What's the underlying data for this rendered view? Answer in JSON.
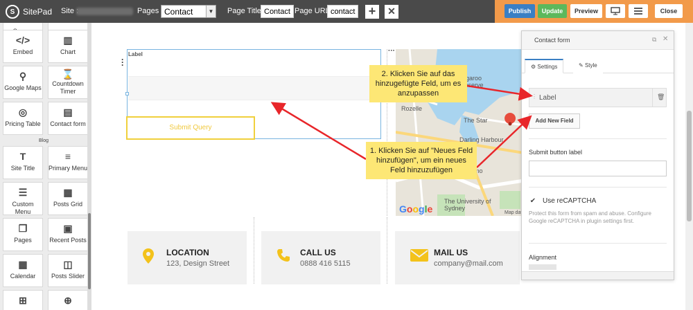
{
  "topbar": {
    "brand": "SitePad",
    "site_label": "Site :",
    "pages_label": "Pages :",
    "pages_value": "Contact",
    "page_title_label": "Page Title:",
    "page_title_value": "Contact",
    "page_url_label": "Page URL:",
    "page_url_value": "contact",
    "add_icon": "+",
    "close_icon": "✕",
    "publish": "Publish",
    "update": "Update",
    "preview": "Preview",
    "close": "Close",
    "colors": {
      "bar": "#4a4a4a",
      "accent": "#f29a4a",
      "publish": "#3a7fc4",
      "update": "#5cb85c"
    }
  },
  "sidebar": {
    "top_cut_label": "Screen",
    "widgets": [
      {
        "label": "Embed",
        "icon": "code-icon"
      },
      {
        "label": "Chart",
        "icon": "chart-icon"
      },
      {
        "label": "Google Maps",
        "icon": "map-icon"
      },
      {
        "label": "Countdown Timer",
        "icon": "hourglass-icon"
      },
      {
        "label": "Pricing Table",
        "icon": "pricing-icon"
      },
      {
        "label": "Contact form",
        "icon": "form-icon"
      }
    ],
    "blog_category": "Blog",
    "blog_widgets": [
      {
        "label": "Site Title",
        "icon": "text-icon"
      },
      {
        "label": "Primary Menu",
        "icon": "menu-icon"
      },
      {
        "label": "Custom Menu",
        "icon": "list-icon"
      },
      {
        "label": "Posts Grid",
        "icon": "grid-icon"
      },
      {
        "label": "Pages",
        "icon": "pages-icon"
      },
      {
        "label": "Recent Posts",
        "icon": "recent-icon"
      },
      {
        "label": "Calendar",
        "icon": "calendar-icon"
      },
      {
        "label": "Posts Slider",
        "icon": "slider-icon"
      }
    ]
  },
  "canvas": {
    "form_label": "Label",
    "submit_label": "Submit Query",
    "map": {
      "labels": [
        "Barangaroo",
        "Reserve",
        "Rozelle",
        "The Star",
        "Darling Harbour",
        "Ultimo",
        "The University of Sydney",
        "Map dat"
      ],
      "google": "Google"
    },
    "info": [
      {
        "title": "LOCATION",
        "text": "123, Design Street",
        "icon": "pin-icon"
      },
      {
        "title": "CALL US",
        "text": "0888 416 5115",
        "icon": "phone-icon"
      },
      {
        "title": "MAIL US",
        "text": "company@mail.com",
        "icon": "mail-icon"
      }
    ],
    "icon_color": "#f3c21b"
  },
  "callouts": {
    "step2": "2. Klicken Sie auf das hinzugefügte Feld, um es anzupassen",
    "step1": "1. Klicken Sie auf \"Neues Feld hinzufügen\", um ein neues Feld hinzuzufügen"
  },
  "panel": {
    "title": "Contact form",
    "tab_settings": "Settings",
    "tab_style": "Style",
    "field_label": "Label",
    "add_new_field": "Add New Field",
    "submit_button_label": "Submit button label",
    "use_recaptcha": "Use reCAPTCHA",
    "recaptcha_help": "Protect this form from spam and abuse. Configure Google reCAPTCHA in plugin settings first.",
    "alignment": "Alignment"
  }
}
